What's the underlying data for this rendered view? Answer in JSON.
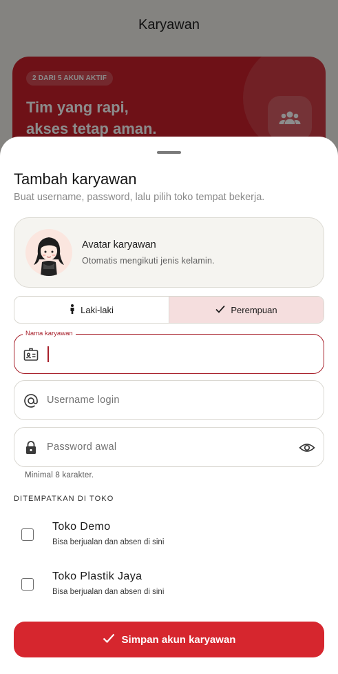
{
  "background": {
    "page_title": "Karyawan",
    "badge": "2 DARI 5 AKUN AKTIF",
    "headline_line1": "Tim yang rapi,",
    "headline_line2": "akses tetap aman.",
    "people_icon": "people-icon",
    "accent_color": "#c8202b"
  },
  "sheet": {
    "title": "Tambah karyawan",
    "subtitle": "Buat username, password, lalu pilih toko tempat bekerja.",
    "avatar_card": {
      "title": "Avatar karyawan",
      "subtitle": "Otomatis mengikuti jenis kelamin."
    },
    "gender": {
      "options": [
        {
          "label": "Laki-laki",
          "icon": "male-icon",
          "selected": false
        },
        {
          "label": "Perempuan",
          "icon": "check-icon",
          "selected": true
        }
      ]
    },
    "fields": {
      "name": {
        "label": "Nama karyawan",
        "value": "",
        "icon": "id-card-icon"
      },
      "username": {
        "placeholder": "Username login",
        "value": "",
        "icon": "at-icon"
      },
      "password": {
        "placeholder": "Password awal",
        "value": "",
        "icon": "lock-icon",
        "helper": "Minimal 8 karakter."
      }
    },
    "stores": {
      "section_label": "DITEMPATKAN DI TOKO",
      "items": [
        {
          "name": "Toko Demo",
          "description": "Bisa berjualan dan absen di sini",
          "checked": false
        },
        {
          "name": "Toko Plastik Jaya",
          "description": "Bisa berjualan dan absen di sini",
          "checked": false
        }
      ]
    },
    "save_label": "Simpan akun karyawan",
    "primary_color": "#d6262e"
  }
}
